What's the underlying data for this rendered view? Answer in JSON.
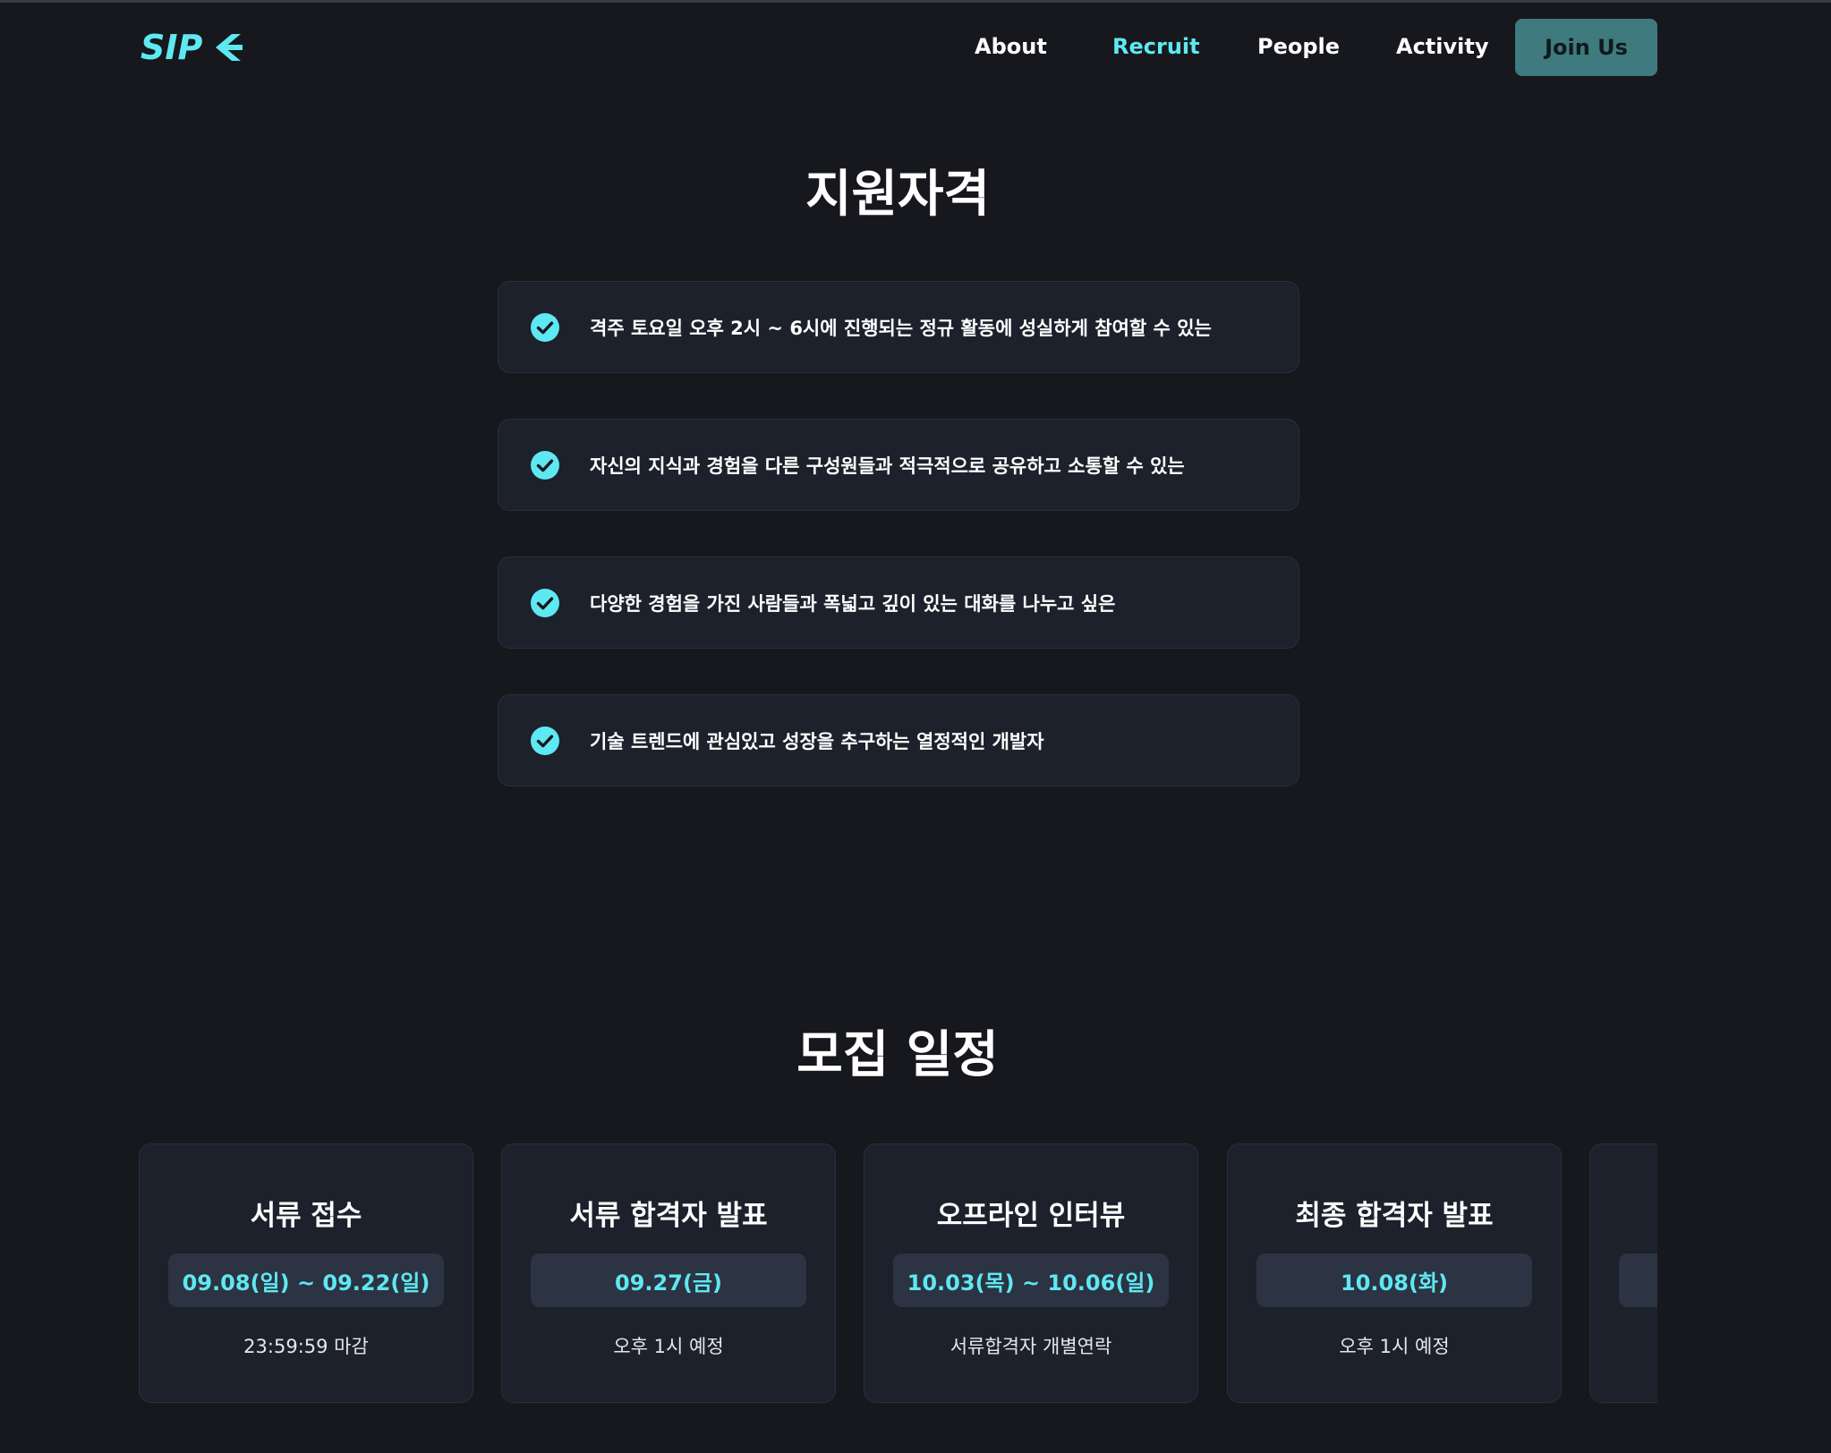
{
  "header": {
    "logo_text": "SIP",
    "nav": [
      "About",
      "Recruit",
      "People",
      "Activity"
    ],
    "active_nav": "Recruit",
    "join_label": "Join Us"
  },
  "qualifications": {
    "title": "지원자격",
    "items": [
      "격주 토요일 오후 2시 ~ 6시에 진행되는 정규 활동에 성실하게 참여할 수 있는",
      "자신의 지식과 경험을 다른 구성원들과 적극적으로 공유하고 소통할 수 있는",
      "다양한 경험을 가진 사람들과 폭넓고 깊이 있는 대화를 나누고 싶은",
      "기술 트렌드에 관심있고 성장을 추구하는 열정적인 개발자"
    ]
  },
  "schedule": {
    "title": "모집 일정",
    "items": [
      {
        "title": "서류 접수",
        "date": "09.08(일) ~ 09.22(일)",
        "note": "23:59:59 마감"
      },
      {
        "title": "서류 합격자 발표",
        "date": "09.27(금)",
        "note": "오후 1시 예정"
      },
      {
        "title": "오프라인 인터뷰",
        "date": "10.03(목) ~ 10.06(일)",
        "note": "서류합격자 개별연락"
      },
      {
        "title": "최종 합격자 발표",
        "date": "10.08(화)",
        "note": "오후 1시 예정"
      },
      {
        "title": "",
        "date": "",
        "note": ""
      }
    ]
  },
  "colors": {
    "background": "#16181d",
    "accent": "#5ee8f2",
    "card": "#1d212b",
    "join_button": "#3f7a7e"
  }
}
